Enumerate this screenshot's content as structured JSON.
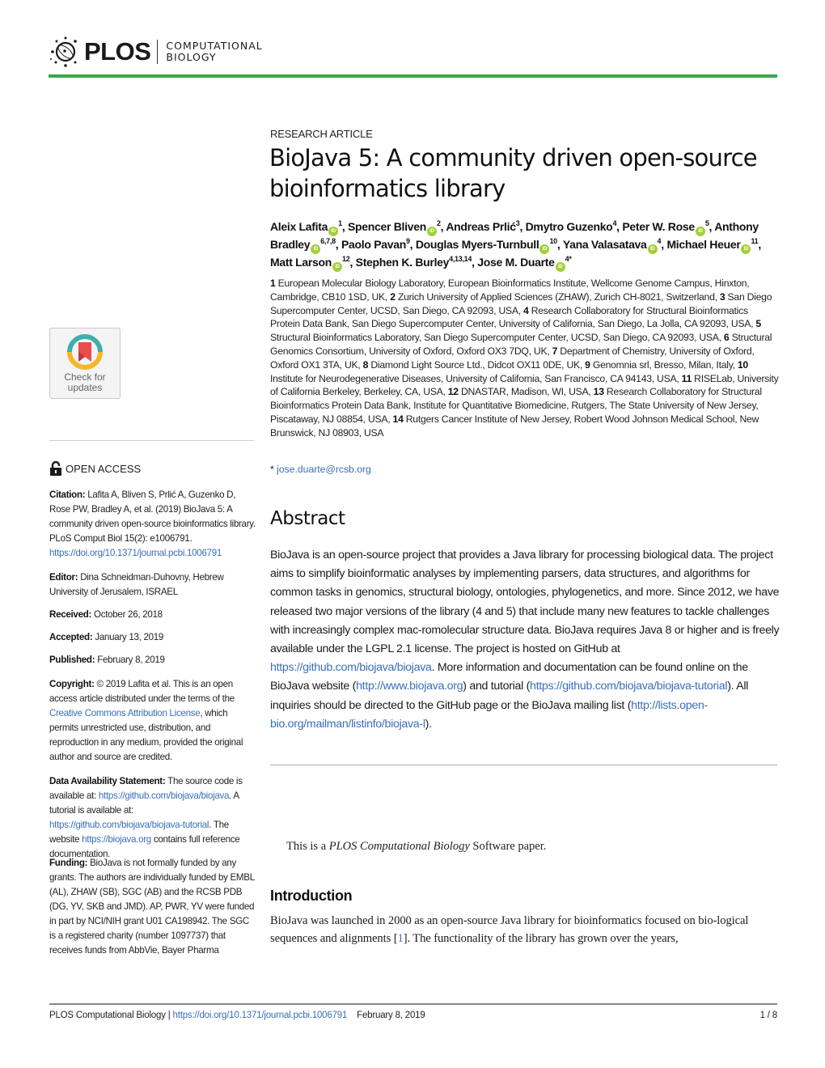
{
  "header": {
    "publisher": "PLOS",
    "journal_line1": "COMPUTATIONAL",
    "journal_line2": "BIOLOGY",
    "accent_color": "#3aa64a"
  },
  "article": {
    "type": "RESEARCH ARTICLE",
    "title": "BioJava 5: A community driven open-source bioinformatics library",
    "authors": [
      {
        "name": "Aleix Lafita",
        "orcid": true,
        "aff": "1"
      },
      {
        "name": "Spencer Bliven",
        "orcid": true,
        "aff": "2"
      },
      {
        "name": "Andreas Prlić",
        "orcid": false,
        "aff": "3"
      },
      {
        "name": "Dmytro Guzenko",
        "orcid": false,
        "aff": "4"
      },
      {
        "name": "Peter W. Rose",
        "orcid": true,
        "aff": "5"
      },
      {
        "name": "Anthony Bradley",
        "orcid": true,
        "aff": "6,7,8"
      },
      {
        "name": "Paolo Pavan",
        "orcid": false,
        "aff": "9"
      },
      {
        "name": "Douglas Myers-Turnbull",
        "orcid": true,
        "aff": "10"
      },
      {
        "name": "Yana Valasatava",
        "orcid": true,
        "aff": "4"
      },
      {
        "name": "Michael Heuer",
        "orcid": true,
        "aff": "11"
      },
      {
        "name": "Matt Larson",
        "orcid": true,
        "aff": "12"
      },
      {
        "name": "Stephen K. Burley",
        "orcid": false,
        "aff": "4,13,14"
      },
      {
        "name": "Jose M. Duarte",
        "orcid": true,
        "aff": "4",
        "corresponding": true
      }
    ],
    "orcid_icon_label": "iD",
    "affiliations": [
      {
        "num": "1",
        "text": "European Molecular Biology Laboratory, European Bioinformatics Institute, Wellcome Genome Campus, Hinxton, Cambridge, CB10 1SD, UK"
      },
      {
        "num": "2",
        "text": "Zurich University of Applied Sciences (ZHAW), Zurich CH-8021, Switzerland"
      },
      {
        "num": "3",
        "text": "San Diego Supercomputer Center, UCSD, San Diego, CA 92093, USA"
      },
      {
        "num": "4",
        "text": "Research Collaboratory for Structural Bioinformatics Protein Data Bank, San Diego Supercomputer Center, University of California, San Diego, La Jolla, CA 92093, USA"
      },
      {
        "num": "5",
        "text": "Structural Bioinformatics Laboratory, San Diego Supercomputer Center, UCSD, San Diego, CA 92093, USA"
      },
      {
        "num": "6",
        "text": "Structural Genomics Consortium, University of Oxford, Oxford OX3 7DQ, UK"
      },
      {
        "num": "7",
        "text": "Department of Chemistry, University of Oxford, Oxford OX1 3TA, UK"
      },
      {
        "num": "8",
        "text": "Diamond Light Source Ltd., Didcot OX11 0DE, UK"
      },
      {
        "num": "9",
        "text": "Genomnia srl, Bresso, Milan, Italy"
      },
      {
        "num": "10",
        "text": "Institute for Neurodegenerative Diseases, University of California, San Francisco, CA 94143, USA"
      },
      {
        "num": "11",
        "text": "RISELab, University of California Berkeley, Berkeley, CA, USA"
      },
      {
        "num": "12",
        "text": "DNASTAR, Madison, WI, USA"
      },
      {
        "num": "13",
        "text": "Research Collaboratory for Structural Bioinformatics Protein Data Bank, Institute for Quantitative Biomedicine, Rutgers, The State University of New Jersey, Piscataway, NJ 08854, USA"
      },
      {
        "num": "14",
        "text": "Rutgers Cancer Institute of New Jersey, Robert Wood Johnson Medical School, New Brunswick, NJ 08903, USA"
      }
    ],
    "correspondence_marker": "*",
    "correspondence_email": "jose.duarte@rcsb.org"
  },
  "sidebar": {
    "crossmark_label_line1": "Check for",
    "crossmark_label_line2": "updates",
    "open_access": "OPEN ACCESS",
    "citation_label": "Citation:",
    "citation_text": "Lafita A, Bliven S, Prlić A, Guzenko D, Rose PW, Bradley A, et al. (2019) BioJava 5: A community driven open-source bioinformatics library. PLoS Comput Biol 15(2): e1006791.",
    "citation_doi": "https://doi.org/10.1371/journal.pcbi.1006791",
    "editor_label": "Editor:",
    "editor_text": "Dina Schneidman-Duhovny, Hebrew University of Jerusalem, ISRAEL",
    "received_label": "Received:",
    "received_date": "October 26, 2018",
    "accepted_label": "Accepted:",
    "accepted_date": "January 13, 2019",
    "published_label": "Published:",
    "published_date": "February 8, 2019",
    "copyright_label": "Copyright:",
    "copyright_pre": "© 2019 Lafita et al. This is an open access article distributed under the terms of the",
    "copyright_link": "Creative Commons Attribution License",
    "copyright_post": ", which permits unrestricted use, distribution, and reproduction in any medium, provided the original author and source are credited.",
    "data_label": "Data Availability Statement:",
    "data_pre": "The source code is available at:",
    "data_link1": "https://github.com/biojava/biojava",
    "data_mid": ". A tutorial is available at:",
    "data_link2": "https://github.com/biojava/biojava-tutorial",
    "data_mid2": ". The website",
    "data_link3": "https://biojava.org",
    "data_post": "contains full reference documentation.",
    "funding_label": "Funding:",
    "funding_text": "BioJava is not formally funded by any grants. The authors are individually funded by EMBL (AL), ZHAW (SB), SGC (AB) and the RCSB PDB (DG, YV, SKB and JMD). AP, PWR, YV were funded in part by NCI/NIH grant U01 CA198942. The SGC is a registered charity (number 1097737) that receives funds from AbbVie, Bayer Pharma"
  },
  "abstract": {
    "heading": "Abstract",
    "text1": "BioJava is an open-source project that provides a Java library for processing biological data. The project aims to simplify bioinformatic analyses by implementing parsers, data structures, and algorithms for common tasks in genomics, structural biology, ontologies, phylogenetics, and more. Since 2012, we have released two major versions of the library (4 and 5) that include many new features to tackle challenges with increasingly complex mac-romolecular structure data. BioJava requires Java 8 or higher and is freely available under the LGPL 2.1 license. The project is hosted on GitHub at",
    "link1": "https://github.com/biojava/biojava",
    "text2": ". More information and documentation can be found online on the BioJava website (",
    "link2": "http://www.biojava.org",
    "text3": ") and tutorial (",
    "link3": "https://github.com/biojava/biojava-tutorial",
    "text4": "). All inquiries should be directed to the GitHub page or the BioJava mailing list (",
    "link4": "http://lists.open-bio.org/mailman/listinfo/biojava-l",
    "text5": ")."
  },
  "software_note": {
    "pre": "This is a",
    "journal": "PLOS Computational Biology",
    "post": "Software paper."
  },
  "introduction": {
    "heading": "Introduction",
    "text1": "BioJava was launched in 2000 as an open-source Java library for bioinformatics focused on bio-logical sequences and alignments [",
    "ref": "1",
    "text2": "]. The functionality of the library has grown over the years,"
  },
  "footer": {
    "journal": "PLOS Computational Biology |",
    "doi": "https://doi.org/10.1371/journal.pcbi.1006791",
    "date": "February 8, 2019",
    "page": "1 / 8"
  }
}
